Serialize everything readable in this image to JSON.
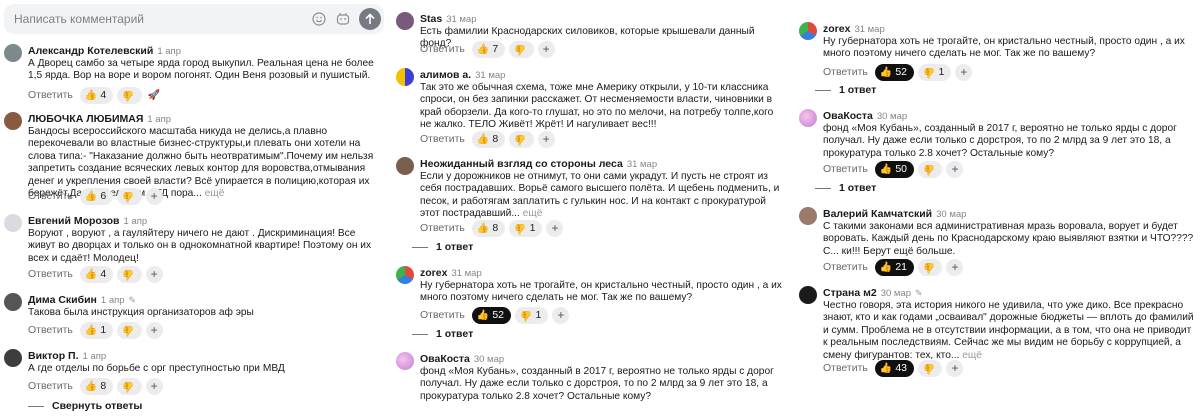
{
  "input": {
    "placeholder": "Написать комментарий"
  },
  "colors": {
    "pill_bg": "#ececee",
    "pill_dark": "#101010"
  },
  "col1": [
    {
      "name": "Александр Котелевский",
      "date": "1 апр",
      "text": "А Дворец самбо за четыре ярда город выкупил. Реальная цена не более 1,5 ярда. Вор на воре и вором погонят. Один Веня розовый и пушистый.",
      "reply": "Ответить",
      "likes": "4"
    },
    {
      "name": "ЛЮБОЧКА ЛЮБИМАЯ",
      "date": "1 апр",
      "text": "Бандосы всероссийского масштаба никуда не делись,а плавно перекочевали во властные бизнес-структуры,и плевать они хотели на слова типа:- \"Наказание должно быть неотвратимым\".Почему им нельзя запретить создание всяческих левых контор для воровства,отмывания денег и укрепления своей власти? Всё упирается в полицию,которая их бережёт,Да и сидельцам в ГД пора...",
      "more": "ещё",
      "reply": "Ответить",
      "likes": "6"
    },
    {
      "name": "Евгений Морозов",
      "date": "1 апр",
      "text": "Воруют , воруют , а гауляйтеру ничего не дают . Дискриминация! Все живут во дворцах и только он в однокомнатной квартире! Поэтому он их всех и сдаёт! Молодец!",
      "reply": "Ответить",
      "likes": "4"
    },
    {
      "name": "Дима Скибин",
      "date": "1 апр",
      "text": "Такова была инструкция организаторов аф эры",
      "reply": "Ответить",
      "likes": "1"
    },
    {
      "name": "Виктор П.",
      "date": "1 апр",
      "text": "А где отделы по борьбе с орг преступностью при МВД",
      "reply": "Ответить",
      "likes": "8",
      "collapse": "Свернуть ответы"
    }
  ],
  "col2": [
    {
      "name": "Stas",
      "date": "31 мар",
      "text": "Есть фамилии Краснодарских силовиков, которые крышевали данный фонд?",
      "reply": "Ответить",
      "likes": "7"
    },
    {
      "name": "алимов а.",
      "date": "31 мар",
      "text": "Так это же обычная схема, тоже мне Америку открыли, у 10-ти классника спроси, он без запинки расскажет. От несменяемости власти, чиновники в край оборзели. Да кого-то глушат, но это по мелочи, на потребу толпе,кого не жалко. ТЕЛО Живёт! Жрёт! И нагуливает вес!!!",
      "reply": "Ответить",
      "likes": "8"
    },
    {
      "name": "Неожиданный взгляд со стороны леса",
      "date": "31 мар",
      "text": "Если у дорожников не отнимут, то они сами украдут. И пусть не строят из себя пострадавших. Ворьё самого высшего полёта. И щебень подменить, и песок, и работягам заплатить с гулькин нос. И на контакт с прокуратурой этот пострадавший...",
      "more": "ещё",
      "reply": "Ответить",
      "likes": "8",
      "dislikes": "1",
      "replies": "1 ответ"
    },
    {
      "name": "zorex",
      "date": "31 мар",
      "text": "Ну губернатора хоть не трогайте, он кристально честный, просто один , а их много поэтому ничего сделать не мог. Так же по вашему?",
      "reply": "Ответить",
      "likes": "52",
      "dislikes": "1",
      "replies": "1 ответ"
    },
    {
      "name": "ОваКоста",
      "date": "30 мар",
      "text": "фонд «Моя Кубань», созданный в 2017 г, вероятно не только ярды с дорог получал. Ну даже если только с дорстроя, то по 2 млрд за 9 лет это 18, а прокуратура только 2.8 хочет? Остальные кому?"
    }
  ],
  "col3": [
    {
      "name": "zorex",
      "date": "31 мар",
      "text": "Ну губернатора хоть не трогайте, он кристально честный, просто один , а их много поэтому ничего сделать не мог. Так же по вашему?",
      "reply": "Ответить",
      "likes": "52",
      "dislikes": "1",
      "replies": "1 ответ"
    },
    {
      "name": "ОваКоста",
      "date": "30 мар",
      "text": "фонд «Моя Кубань», созданный в 2017 г, вероятно не только ярды с дорог получал. Ну даже если только с дорстроя, то по 2 млрд за 9 лет это 18, а прокуратура только 2.8 хочет? Остальные кому?",
      "reply": "Ответить",
      "likes": "50",
      "replies": "1 ответ"
    },
    {
      "name": "Валерий Камчатский",
      "date": "30 мар",
      "text": "С такими законами вся административная мразь воровала, ворует и будет воровать. Каждый день по Краснодарскому краю выявляют взятки и ЧТО???? С... ки!!! Берут ещё больше.",
      "reply": "Ответить",
      "likes": "21"
    },
    {
      "name": "Страна м2",
      "date": "30 мар",
      "text": "Честно говоря, эта история никого не удивила, что уже дико. Все прекрасно знают, кто и как годами „осваивал\" дорожные бюджеты — вплоть до фамилий и сумм. Проблема не в отсутствии информации, а в том, что она не приводит к реальным последствиям. Сейчас же мы видим не борьбу с коррупцией, а смену фигурантов: тех, кто...",
      "more": "ещё",
      "reply": "Ответить",
      "likes": "43"
    }
  ]
}
